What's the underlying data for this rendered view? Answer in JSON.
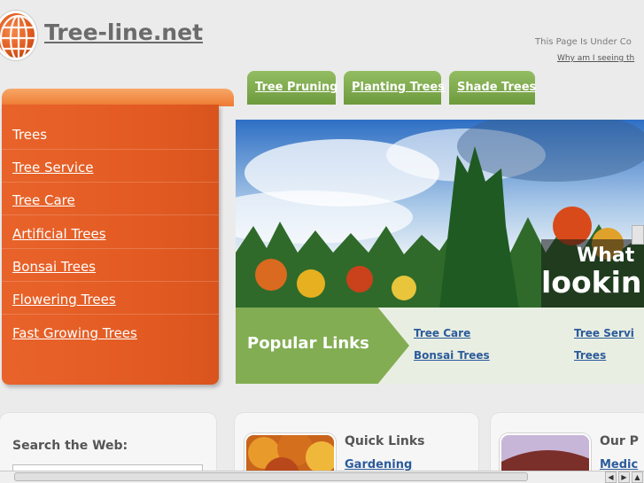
{
  "header": {
    "site_name": "Tree-line.net",
    "under_construction": "This Page Is Under Co",
    "why_link": "Why am I seeing th"
  },
  "tabs": [
    {
      "label": "Tree Pruning"
    },
    {
      "label": "Planting Trees"
    },
    {
      "label": "Shade Trees"
    }
  ],
  "menu": {
    "items": [
      {
        "label": "Trees",
        "link": false
      },
      {
        "label": "Tree Service",
        "link": true
      },
      {
        "label": "Tree Care",
        "link": true
      },
      {
        "label": "Artificial Trees",
        "link": true
      },
      {
        "label": "Bonsai Trees",
        "link": true
      },
      {
        "label": "Flowering Trees",
        "link": true
      },
      {
        "label": "Fast Growing Trees",
        "link": true
      }
    ]
  },
  "hero": {
    "line1": "What",
    "line2": "lookin"
  },
  "popular": {
    "title": "Popular Links",
    "links": [
      "Tree Care",
      "Bonsai Trees",
      "Tree Servi",
      "Trees"
    ]
  },
  "cards": {
    "search_title": "Search the Web:",
    "quick_title": "Quick Links",
    "quick_link": "Gardening",
    "our_title": "Our P",
    "our_link": "Medic"
  },
  "colors": {
    "menu_orange": "#e25a22",
    "tab_green": "#7aa64a",
    "link_blue": "#2b5b9b",
    "page_bg": "#ebebeb"
  }
}
